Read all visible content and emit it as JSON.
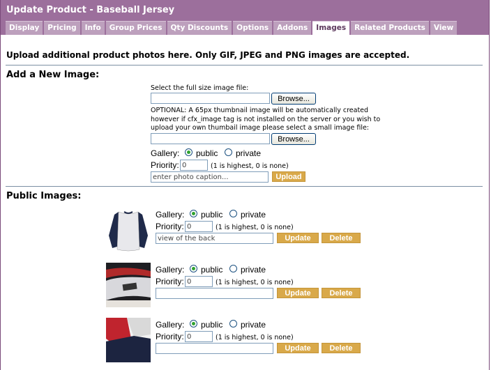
{
  "title": "Update Product - Baseball Jersey",
  "tabs": [
    "Display",
    "Pricing",
    "Info",
    "Group Prices",
    "Qty Discounts",
    "Options",
    "Addons",
    "Images",
    "Related Products",
    "View"
  ],
  "active_tab": "Images",
  "intro": "Upload additional product photos here. Only GIF, JPEG and PNG images are accepted.",
  "add_section": {
    "heading": "Add a New Image:",
    "select_label": "Select the full size image file:",
    "browse_label": "Browse...",
    "optional_line1": "OPTIONAL: A 65px thumbnail image will be automatically created",
    "optional_line2": "however if cfx_image tag is not installed on the server or you wish to",
    "optional_line3": "upload your own thumbail image please select a small image file:",
    "gallery_label": "Gallery:",
    "public_label": "public",
    "private_label": "private",
    "priority_label": "Priority:",
    "priority_value": "0",
    "priority_hint": "(1 is highest, 0 is none)",
    "caption_placeholder": "enter photo caption...",
    "upload_label": "Upload"
  },
  "public_section": {
    "heading": "Public Images:",
    "update_label": "Update",
    "delete_label": "Delete",
    "images": [
      {
        "thumb_icon": "jersey-front-thumbnail",
        "gallery": "public",
        "priority": "0",
        "caption": "view of the back"
      },
      {
        "thumb_icon": "jersey-collar-thumbnail",
        "gallery": "public",
        "priority": "0",
        "caption": ""
      },
      {
        "thumb_icon": "jersey-sleeve-thumbnail",
        "gallery": "public",
        "priority": "0",
        "caption": ""
      }
    ]
  },
  "colors": {
    "header": "#9c6f9c",
    "tab": "#bda0bd",
    "button": "#d9a94a"
  }
}
